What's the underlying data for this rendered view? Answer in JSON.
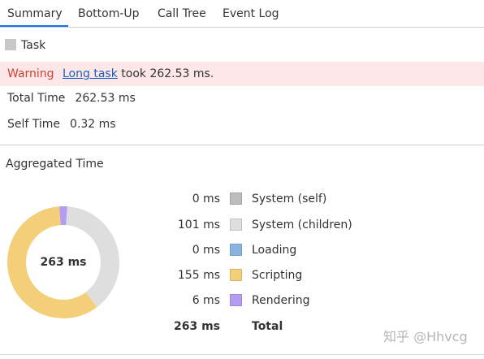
{
  "tabs": [
    {
      "label": "Summary",
      "active": true
    },
    {
      "label": "Bottom-Up",
      "active": false
    },
    {
      "label": "Call Tree",
      "active": false
    },
    {
      "label": "Event Log",
      "active": false
    }
  ],
  "task": {
    "label": "Task",
    "swatch_color": "#c8c8c8"
  },
  "warning": {
    "label": "Warning",
    "link_text": "Long task",
    "message": " took 262.53 ms."
  },
  "total_time": {
    "label": "Total Time",
    "value": "262.53 ms"
  },
  "self_time": {
    "label": "Self Time",
    "value": "0.32 ms"
  },
  "aggregated": {
    "title": "Aggregated Time",
    "center_label": "263 ms",
    "rows": [
      {
        "value": "0 ms",
        "label": "System (self)",
        "color": "#bdbdbd"
      },
      {
        "value": "101 ms",
        "label": "System (children)",
        "color": "#dedede"
      },
      {
        "value": "0 ms",
        "label": "Loading",
        "color": "#8ab4e0"
      },
      {
        "value": "155 ms",
        "label": "Scripting",
        "color": "#f3cf7a"
      },
      {
        "value": "6 ms",
        "label": "Rendering",
        "color": "#b49cf0"
      }
    ],
    "total": {
      "value": "263 ms",
      "label": "Total"
    }
  },
  "chart_data": {
    "type": "pie",
    "categories": [
      "System (self)",
      "System (children)",
      "Loading",
      "Scripting",
      "Rendering"
    ],
    "values": [
      0,
      101,
      0,
      155,
      6
    ],
    "colors": [
      "#bdbdbd",
      "#dedede",
      "#8ab4e0",
      "#f3cf7a",
      "#b49cf0"
    ]
  },
  "watermark": "知乎 @Hhvcg"
}
